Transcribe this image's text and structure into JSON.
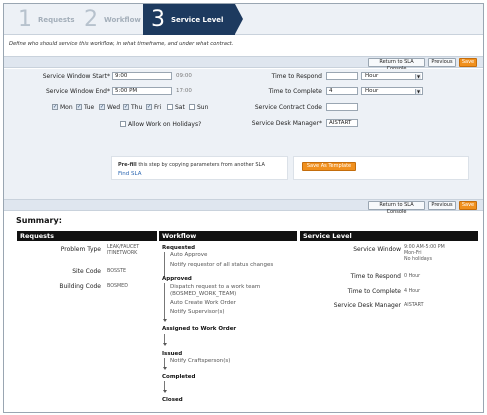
{
  "steps": [
    {
      "num": "1",
      "label": "Requests"
    },
    {
      "num": "2",
      "label": "Workflow"
    },
    {
      "num": "3",
      "label": "Service Level"
    }
  ],
  "instruction": "Define who should service this workflow, in what timeframe, and under what contract.",
  "actions": {
    "return_label": "Return to SLA Console",
    "previous_label": "Previous",
    "save_label": "Save"
  },
  "form": {
    "window_start_label": "Service Window Start*",
    "window_start_value": "9:00",
    "window_start_note": "09:00",
    "window_end_label": "Service Window End*",
    "window_end_value": "5:00 PM",
    "window_end_note": "17:00",
    "days": [
      {
        "label": "Mon",
        "checked": true
      },
      {
        "label": "Tue",
        "checked": true
      },
      {
        "label": "Wed",
        "checked": true
      },
      {
        "label": "Thu",
        "checked": true
      },
      {
        "label": "Fri",
        "checked": true
      },
      {
        "label": "Sat",
        "checked": false
      },
      {
        "label": "Sun",
        "checked": false
      }
    ],
    "allow_holidays_label": "Allow Work on Holidays?",
    "allow_holidays_checked": false,
    "respond_label": "Time to Respond",
    "respond_value": "",
    "respond_unit": "Hour",
    "complete_label": "Time to Complete",
    "complete_value": "4",
    "complete_unit": "Hour",
    "contract_label": "Service Contract Code",
    "contract_value": "",
    "manager_label": "Service Desk Manager*",
    "manager_value": "AISTART",
    "prefill_bold": "Pre-fill",
    "prefill_text": " this step by copying parameters from another SLA",
    "find_sla_label": "Find SLA",
    "save_template_label": "Save As Template"
  },
  "summary": {
    "title": "Summary:",
    "requests_head": "Requests",
    "workflow_head": "Workflow",
    "service_head": "Service Level",
    "problem_type_label": "Problem Type",
    "problem_type_value": "LEAK/FAUCET ITINETWORK",
    "site_code_label": "Site Code",
    "site_code_value": "BOSSTE",
    "building_code_label": "Building Code",
    "building_code_value": "BOSMED",
    "workflow": {
      "requested": "Requested",
      "auto_approve": "Auto Approve",
      "notify_requestor": "Notify requestor of all status changes",
      "approved": "Approved",
      "dispatch": "Dispatch request to a work team",
      "dispatch_team": "(BOSMED_WORK_TEAM)",
      "auto_create": "Auto Create Work Order",
      "notify_supervisor": "Notify Supervisor(s)",
      "assigned": "Assigned to Work Order",
      "issued": "Issued",
      "notify_craftsperson": "Notify Craftsperson(s)",
      "completed": "Completed",
      "closed": "Closed"
    },
    "service_window_label": "Service Window",
    "service_window_value": "9:00 AM-5:00 PM",
    "service_window_days": "Mon-Fri",
    "service_window_holidays": "No holidays",
    "respond_label": "Time to Respond",
    "respond_value": "0 Hour",
    "complete_label": "Time to Complete",
    "complete_value": "4 Hour",
    "manager_label": "Service Desk Manager",
    "manager_value": "AISTART"
  }
}
